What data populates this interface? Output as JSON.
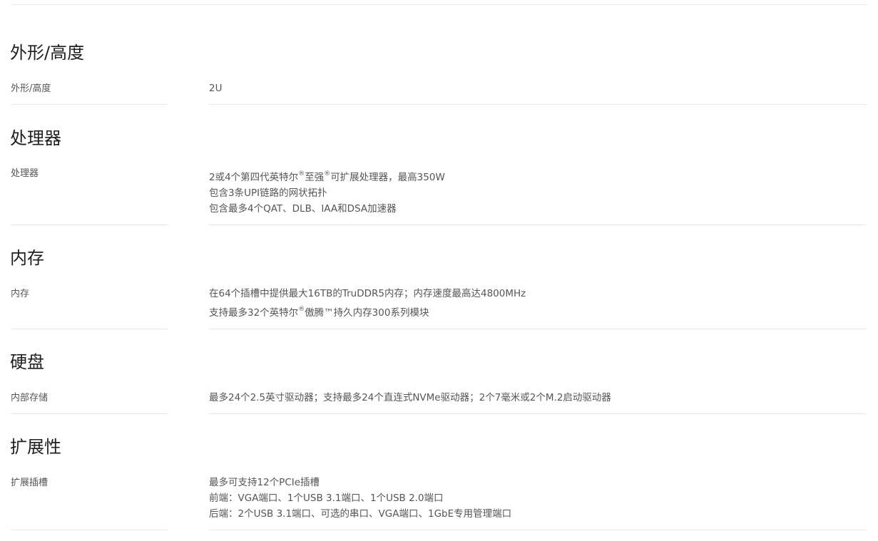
{
  "sections": {
    "form_factor": {
      "title": "外形/高度",
      "label": "外形/高度",
      "lines": [
        "2U"
      ]
    },
    "processor": {
      "title": "处理器",
      "label": "处理器",
      "line1_a": "2或4个第四代英特尔",
      "line1_sup1": "®",
      "line1_b": "至强",
      "line1_sup2": "®",
      "line1_c": "可扩展处理器，最高350W",
      "line2": "包含3条UPI链路的网状拓扑",
      "line3": "包含最多4个QAT、DLB、IAA和DSA加速器"
    },
    "memory": {
      "title": "内存",
      "label": "内存",
      "line1": "在64个插槽中提供最大16TB的TruDDR5内存；内存速度最高达4800MHz",
      "line2_a": "支持最多32个英特尔",
      "line2_sup": "®",
      "line2_b": "傲腾™持久内存300系列模块"
    },
    "storage": {
      "title": "硬盘",
      "label": "内部存储",
      "line1": "最多24个2.5英寸驱动器；支持最多24个直连式NVMe驱动器；2个7毫米或2个M.2启动驱动器"
    },
    "expansion": {
      "title": "扩展性",
      "label": "扩展插槽",
      "line1": "最多可支持12个PCIe插槽",
      "line2": "前端：VGA端口、1个USB 3.1端口、1个USB 2.0端口",
      "line3": "后端：2个USB 3.1端口、可选的串口、VGA端口、1GbE专用管理端口"
    }
  }
}
